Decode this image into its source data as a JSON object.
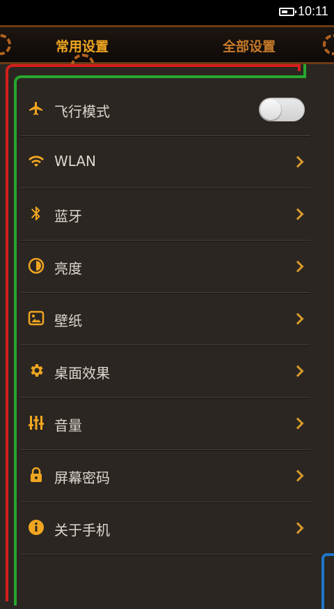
{
  "status_bar": {
    "time": "10:11"
  },
  "tabs": [
    {
      "label": "常用设置",
      "active": true
    },
    {
      "label": "全部设置",
      "active": false
    }
  ],
  "accent_color": "#f0a620",
  "settings": [
    {
      "label": "飞行模式",
      "icon": "airplane-icon",
      "toggle": false
    },
    {
      "label": "WLAN",
      "icon": "wifi-icon"
    },
    {
      "label": "蓝牙",
      "icon": "bluetooth-icon"
    },
    {
      "label": "亮度",
      "icon": "brightness-icon"
    },
    {
      "label": "壁纸",
      "icon": "wallpaper-icon"
    },
    {
      "label": "桌面效果",
      "icon": "gear-icon"
    },
    {
      "label": "音量",
      "icon": "equalizer-icon"
    },
    {
      "label": "屏幕密码",
      "icon": "lock-icon"
    },
    {
      "label": "关于手机",
      "icon": "info-icon"
    }
  ]
}
